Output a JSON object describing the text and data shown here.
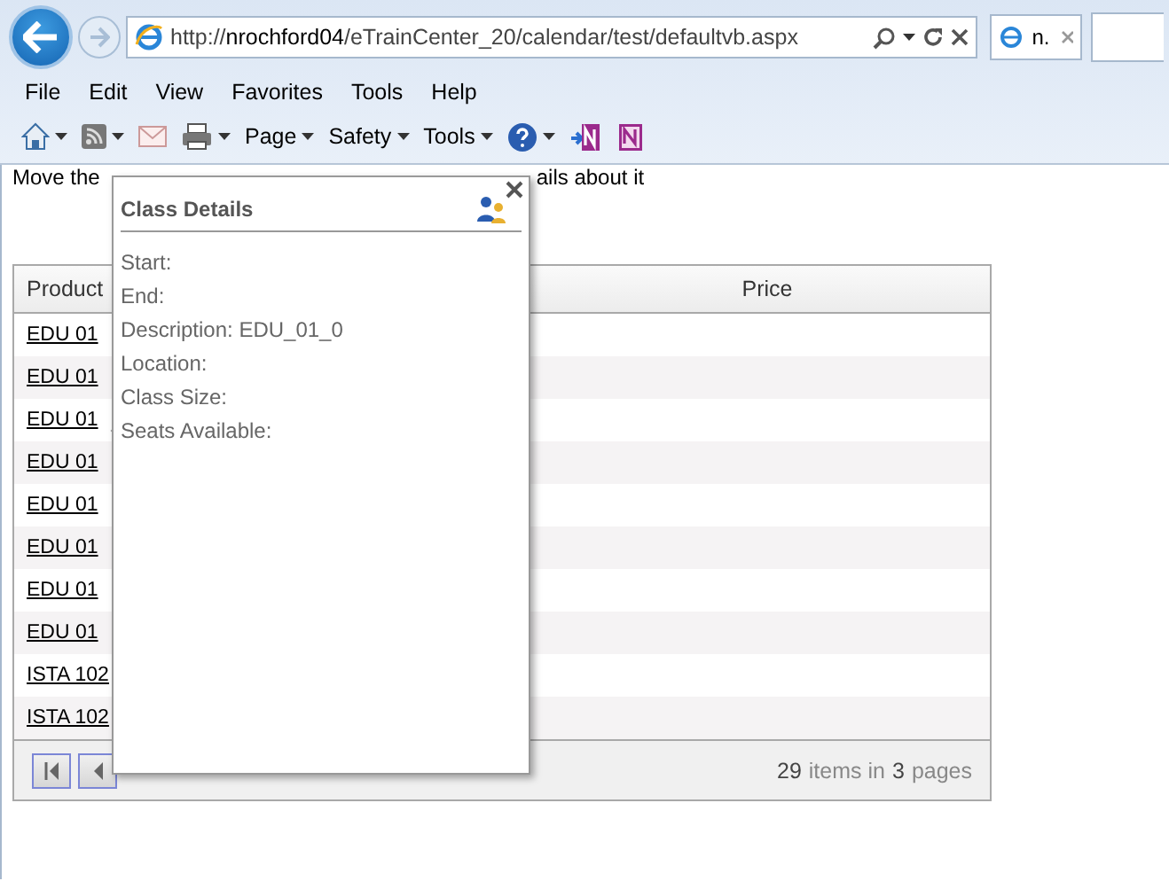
{
  "browser": {
    "url": "http://**nrochford04**/eTrainCenter_20/calendar/test/defaultvb.aspx",
    "tab": {
      "title": "n.",
      "selected": true
    }
  },
  "menu": [
    "File",
    "Edit",
    "View",
    "Favorites",
    "Tools",
    "Help"
  ],
  "commands": [
    {
      "kind": "home"
    },
    {
      "kind": "feed"
    },
    {
      "kind": "mail"
    },
    {
      "kind": "print"
    },
    {
      "kind": "menu",
      "label": "Page"
    },
    {
      "kind": "menu",
      "label": "Safety"
    },
    {
      "kind": "menu",
      "label": "Tools"
    },
    {
      "kind": "help"
    },
    {
      "kind": "onenote"
    },
    {
      "kind": "onenote-link"
    }
  ],
  "page": {
    "instruction_start": "Move the",
    "instruction_end": "ails about it",
    "table": {
      "columns": [
        "Product",
        "Price"
      ],
      "rows": [
        "EDU 01",
        "EDU 01",
        "EDU 01",
        "EDU 01",
        "EDU 01",
        "EDU 01",
        "EDU 01",
        "EDU 01",
        "ISTA 102",
        "ISTA 102"
      ],
      "pager": {
        "item_count": "29",
        "items_label": "items in",
        "page_count": "3",
        "pages_label": "pages"
      }
    },
    "popup": {
      "title": "Class Details",
      "fields": [
        "Start:",
        "End:",
        "Description: EDU_01_0",
        "Location:",
        "Class Size:",
        "Seats Available:"
      ]
    }
  }
}
